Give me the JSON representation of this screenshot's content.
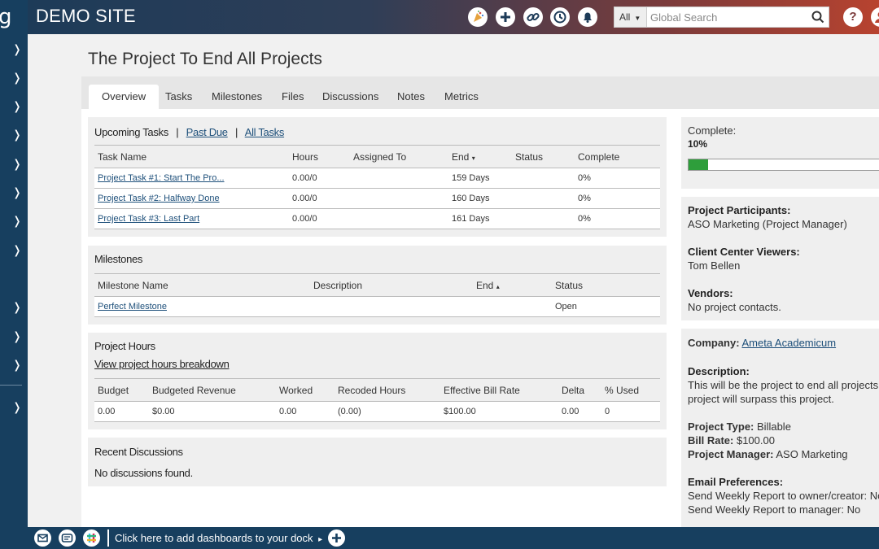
{
  "app": {
    "logo": "g",
    "site_title": "DEMO SITE"
  },
  "topbar": {
    "icons": [
      "party-icon",
      "plus-icon",
      "link-icon",
      "history-icon",
      "bell-icon"
    ],
    "search": {
      "scope": "All",
      "placeholder": "Global Search"
    },
    "help": "?"
  },
  "page": {
    "title": "The Project To End All Projects",
    "tabs": [
      "Overview",
      "Tasks",
      "Milestones",
      "Files",
      "Discussions",
      "Notes",
      "Metrics"
    ],
    "active_tab": "Overview"
  },
  "tasks": {
    "title": "Upcoming Tasks",
    "sep": "|",
    "past_due": "Past Due",
    "all_tasks": "All Tasks",
    "columns": [
      "Task Name",
      "Hours",
      "Assigned To",
      "End",
      "Status",
      "Complete"
    ],
    "end_sort": "▾",
    "rows": [
      {
        "name": "Project Task #1: Start The Pro...",
        "hours": "0.00/0",
        "assigned": "",
        "end": "159 Days",
        "status": "",
        "complete": "0%"
      },
      {
        "name": "Project Task #2: Halfway Done",
        "hours": "0.00/0",
        "assigned": "",
        "end": "160 Days",
        "status": "",
        "complete": "0%"
      },
      {
        "name": "Project Task #3: Last Part",
        "hours": "0.00/0",
        "assigned": "",
        "end": "161 Days",
        "status": "",
        "complete": "0%"
      }
    ]
  },
  "milestones": {
    "title": "Milestones",
    "columns": [
      "Milestone Name",
      "Description",
      "End",
      "Status"
    ],
    "end_sort": "▴",
    "rows": [
      {
        "name": "Perfect Milestone",
        "description": "",
        "end": "",
        "status": "Open"
      }
    ]
  },
  "hours": {
    "title": "Project Hours",
    "link": "View project hours breakdown",
    "columns": [
      "Budget",
      "Budgeted Revenue",
      "Worked",
      "Recoded Hours",
      "Effective Bill Rate",
      "Delta",
      "% Used"
    ],
    "row": [
      "0.00",
      "$0.00",
      "0.00",
      "(0.00)",
      "$100.00",
      "0.00",
      "0"
    ]
  },
  "discussions": {
    "title": "Recent Discussions",
    "empty": "No discussions found."
  },
  "sidebar": {
    "complete_label": "Complete:",
    "complete_value": "10%",
    "complete_fraction": 0.1,
    "participants_label": "Project Participants:",
    "participants_value": "ASO Marketing (Project Manager)",
    "viewers_label": "Client Center Viewers:",
    "viewers_value": "Tom Bellen",
    "vendors_label": "Vendors:",
    "vendors_value": "No project contacts.",
    "company_label": "Company:",
    "company_value": "Ameta Academicum",
    "description_label": "Description:",
    "description_line1": "This will be the project to end all projects",
    "description_line2": "project will surpass this project.",
    "type_label": "Project Type:",
    "type_value": "Billable",
    "rate_label": "Bill Rate:",
    "rate_value": "$100.00",
    "manager_label": "Project Manager:",
    "manager_value": "ASO Marketing",
    "email_label": "Email Preferences:",
    "email_line1": "Send Weekly Report to owner/creator: No",
    "email_line2": "Send Weekly Report to manager: No"
  },
  "dock": {
    "icons": [
      "mail-icon",
      "message-icon",
      "slack-icon"
    ],
    "text": "Click here to add dashboards to your dock",
    "arrow": "▸"
  }
}
